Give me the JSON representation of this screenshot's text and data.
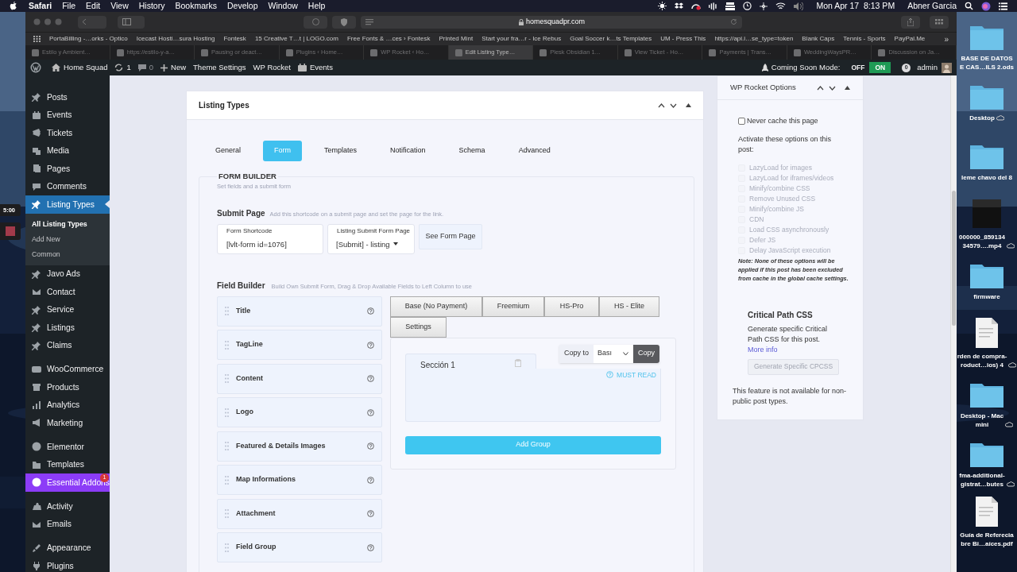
{
  "menu_bar": {
    "app": "Safari",
    "menus": [
      "File",
      "Edit",
      "View",
      "History",
      "Bookmarks",
      "Develop",
      "Window",
      "Help"
    ],
    "clock": "Mon Apr 17  8:13 PM",
    "user": "Abner Garcia"
  },
  "recorder": {
    "time": "5:00"
  },
  "browser": {
    "url": "homesquadpr.com",
    "bookmarks": [
      "PortaBilling -…orks - Optico",
      "Icecast Hosti…sura Hosting",
      "Fontesk",
      "15 Creative T…t | LOGO.com",
      "Free Fonts & …ces › Fontesk",
      "Printed Mint",
      "Start your fra…r - Ice Rebus",
      "Goal Soccer k…ts Templates",
      "UM - Press This",
      "https://api.i…se_type=token",
      "Blank Caps",
      "Tennis - Sports",
      "PayPal.Me"
    ],
    "more": "»",
    "tabs": [
      {
        "title": "Estilo y Ambient…",
        "selected": false
      },
      {
        "title": "https://estilo-y-a…",
        "selected": false
      },
      {
        "title": "Pausing or deact…",
        "selected": false
      },
      {
        "title": "Plugins ‹ Home…",
        "selected": false
      },
      {
        "title": "WP Rocket ‹ Ho…",
        "selected": false
      },
      {
        "title": "Edit Listing Type…",
        "selected": true
      },
      {
        "title": "Plesk Obsidian 1…",
        "selected": false
      },
      {
        "title": "View Ticket - Ho…",
        "selected": false
      },
      {
        "title": "Payments | Trans…",
        "selected": false
      },
      {
        "title": "WeddingWaysPR…",
        "selected": false
      },
      {
        "title": "Discussion on Ja…",
        "selected": false
      }
    ]
  },
  "admin_bar": {
    "site": "Home Squad",
    "updates": "1",
    "comments": "0",
    "new": "New",
    "links": [
      "Theme Settings",
      "WP Rocket",
      "Events"
    ],
    "coming_soon_label": "Coming Soon Mode:",
    "off": "OFF",
    "on": "ON",
    "coming_soon_on": true,
    "notifications": "0",
    "user": "admin"
  },
  "sidebar": {
    "groups": [
      [
        {
          "label": "Posts",
          "selected": false,
          "highlighted": false
        },
        {
          "label": "Events",
          "selected": false,
          "highlighted": false
        },
        {
          "label": "Tickets",
          "selected": false,
          "highlighted": false
        },
        {
          "label": "Media",
          "selected": false,
          "highlighted": false
        },
        {
          "label": "Pages",
          "selected": false,
          "highlighted": false
        },
        {
          "label": "Comments",
          "selected": false,
          "highlighted": false
        },
        {
          "label": "Listing Types",
          "selected": true,
          "highlighted": false,
          "children": [
            {
              "label": "All Listing Types",
              "selected": true
            },
            {
              "label": "Add New",
              "selected": false
            },
            {
              "label": "Common",
              "selected": false
            }
          ]
        },
        {
          "label": "Javo Ads",
          "selected": false,
          "highlighted": false
        },
        {
          "label": "Contact",
          "selected": false,
          "highlighted": false
        },
        {
          "label": "Service",
          "selected": false,
          "highlighted": false
        },
        {
          "label": "Listings",
          "selected": false,
          "highlighted": false
        },
        {
          "label": "Claims",
          "selected": false,
          "highlighted": false
        }
      ],
      [
        {
          "label": "WooCommerce",
          "selected": false,
          "highlighted": false
        },
        {
          "label": "Products",
          "selected": false,
          "highlighted": false
        },
        {
          "label": "Analytics",
          "selected": false,
          "highlighted": false
        },
        {
          "label": "Marketing",
          "selected": false,
          "highlighted": false
        }
      ],
      [
        {
          "label": "Elementor",
          "selected": false,
          "highlighted": false
        },
        {
          "label": "Templates",
          "selected": false,
          "highlighted": false
        },
        {
          "label": "Essential Addons",
          "selected": false,
          "highlighted": true,
          "badge": "1"
        }
      ],
      [
        {
          "label": "Activity",
          "selected": false,
          "highlighted": false
        },
        {
          "label": "Emails",
          "selected": false,
          "highlighted": false
        }
      ],
      [
        {
          "label": "Appearance",
          "selected": false,
          "highlighted": false
        },
        {
          "label": "Plugins",
          "selected": false,
          "highlighted": false
        }
      ]
    ]
  },
  "listing_card": {
    "title": "Listing Types",
    "tabs": [
      {
        "label": "General",
        "selected": false
      },
      {
        "label": "Form",
        "selected": true
      },
      {
        "label": "Templates",
        "selected": false
      },
      {
        "label": "Notification",
        "selected": false
      },
      {
        "label": "Schema",
        "selected": false
      },
      {
        "label": "Advanced",
        "selected": false
      }
    ],
    "form_builder": {
      "legend": "FORM BUILDER",
      "hint": "Set fields and a submit form",
      "submit_page": {
        "label": "Submit Page",
        "hint": "Add this shortcode on a submit page and set the page for the link.",
        "shortcode_label": "Form Shortcode",
        "shortcode": "[lvlt-form id=1076]",
        "page_label": "Listing Submit Form Page",
        "page": "[Submit] - listing",
        "button": "See Form Page"
      },
      "field_builder": {
        "label": "Field Builder",
        "hint": "Build Own Submit Form, Drag & Drop Available Fields to Left Column to use",
        "fields": [
          "Title",
          "TagLine",
          "Content",
          "Logo",
          "Featured & Details Images",
          "Map Informations",
          "Attachment",
          "Field Group"
        ],
        "plans": [
          "Base (No Payment)",
          "Freemium",
          "HS-Pro",
          "HS - Elite",
          "Settings"
        ],
        "copy_label": "Copy to",
        "copy_target": "Bası",
        "copy_button": "Copy",
        "section": "Sección 1",
        "must_read": "MUST READ",
        "add_group": "Add Group"
      }
    }
  },
  "rocket": {
    "title": "WP Rocket Options",
    "never_cache": {
      "label": "Never cache this page",
      "checked": false
    },
    "intro": "Activate these options on this post:",
    "options": [
      {
        "label": "LazyLoad for images",
        "checked": false,
        "disabled": true
      },
      {
        "label": "LazyLoad for iframes/videos",
        "checked": false,
        "disabled": true
      },
      {
        "label": "Minify/combine CSS",
        "checked": false,
        "disabled": true
      },
      {
        "label": "Remove Unused CSS",
        "checked": false,
        "disabled": true
      },
      {
        "label": "Minify/combine JS",
        "checked": false,
        "disabled": true
      },
      {
        "label": "CDN",
        "checked": false,
        "disabled": true
      },
      {
        "label": "Load CSS asynchronously",
        "checked": false,
        "disabled": true
      },
      {
        "label": "Defer JS",
        "checked": false,
        "disabled": true
      },
      {
        "label": "Delay JavaScript execution",
        "checked": false,
        "disabled": true
      }
    ],
    "note": "Note: None of these options will be applied if this post has been excluded from cache in the global cache settings.",
    "cpcss_title": "Critical Path CSS",
    "cpcss_text": "Generate specific Critical Path CSS for this post.",
    "more_info": "More info",
    "cpcss_button": "Generate Specific CPCSS",
    "cpcss_disabled": true,
    "footer": "This feature is not available for non-public post types."
  },
  "desktop": {
    "icons": [
      {
        "label": "BASE DE DATOS\nE CAS…ILS 2.ods",
        "kind": "folder",
        "cloud": false
      },
      {
        "label": "Desktop",
        "kind": "folder",
        "cloud": true
      },
      {
        "label": "leme chavo del 8",
        "kind": "folder",
        "cloud": false
      },
      {
        "label": "000000_859134\n34579….mp4",
        "kind": "video",
        "cloud": true
      },
      {
        "label": "firmware",
        "kind": "folder",
        "cloud": false
      },
      {
        "label": "rden de compra-\nroduct…ios) 4",
        "kind": "document",
        "cloud": true
      },
      {
        "label": "Desktop - Mac\nmini",
        "kind": "folder",
        "cloud": true
      },
      {
        "label": "fma-additional-\ngistrat…butes",
        "kind": "folder",
        "cloud": true
      },
      {
        "label": "Guía de Referecia\nbre Bi…aíces.pdf",
        "kind": "document",
        "cloud": false
      }
    ]
  }
}
